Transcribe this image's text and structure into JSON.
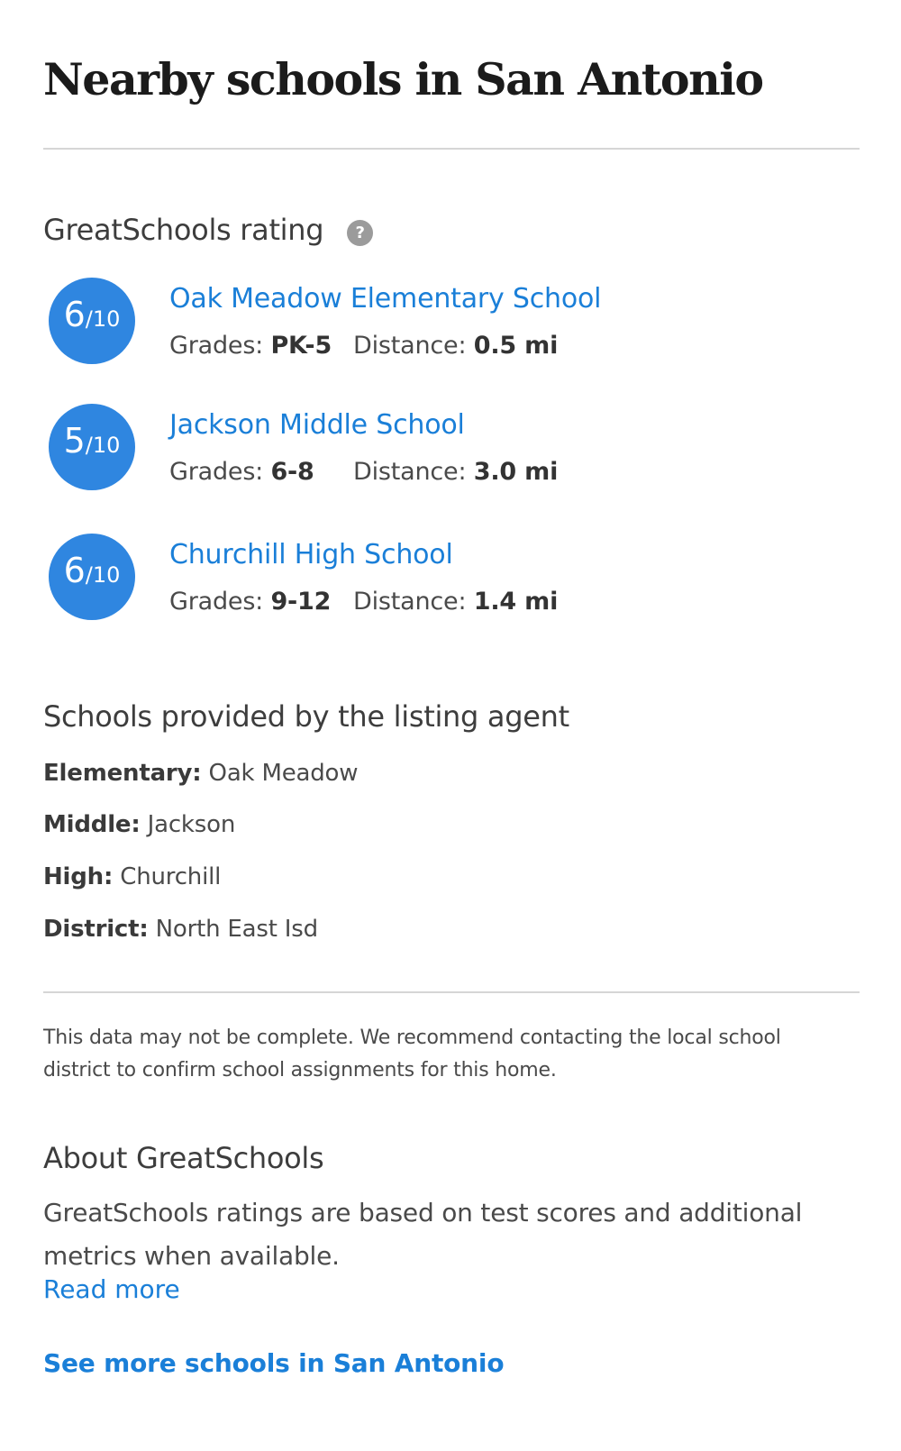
{
  "page": {
    "title": "Nearby schools in  San Antonio"
  },
  "ratings": {
    "header": "GreatSchools rating",
    "help_icon": "question-mark-icon",
    "help_glyph": "?",
    "badge_color": "#2f86e0",
    "link_color": "#1a7fd8",
    "schools": [
      {
        "score": "6",
        "out_of": "/10",
        "name": "Oak Meadow Elementary School",
        "grades_label": "Grades: ",
        "grades": "PK-5",
        "distance_label": "Distance: ",
        "distance": "0.5 mi"
      },
      {
        "score": "5",
        "out_of": "/10",
        "name": "Jackson Middle School",
        "grades_label": "Grades: ",
        "grades": "6-8",
        "distance_label": "Distance: ",
        "distance": "3.0 mi"
      },
      {
        "score": "6",
        "out_of": "/10",
        "name": "Churchill High School",
        "grades_label": "Grades: ",
        "grades": "9-12",
        "distance_label": "Distance: ",
        "distance": "1.4 mi"
      }
    ]
  },
  "agent_schools": {
    "title": "Schools provided by the listing agent",
    "rows": [
      {
        "label": "Elementary:",
        "value": " Oak Meadow"
      },
      {
        "label": "Middle:",
        "value": " Jackson"
      },
      {
        "label": "High:",
        "value": " Churchill"
      },
      {
        "label": "District:",
        "value": " North East Isd"
      }
    ]
  },
  "disclaimer": "This data may not be complete. We recommend contacting the local school district to confirm school assignments for this home.",
  "about": {
    "title": "About GreatSchools",
    "body": "GreatSchools ratings are based on test scores and additional metrics when available.",
    "read_more": "Read more"
  },
  "see_more": "See more schools in San Antonio"
}
